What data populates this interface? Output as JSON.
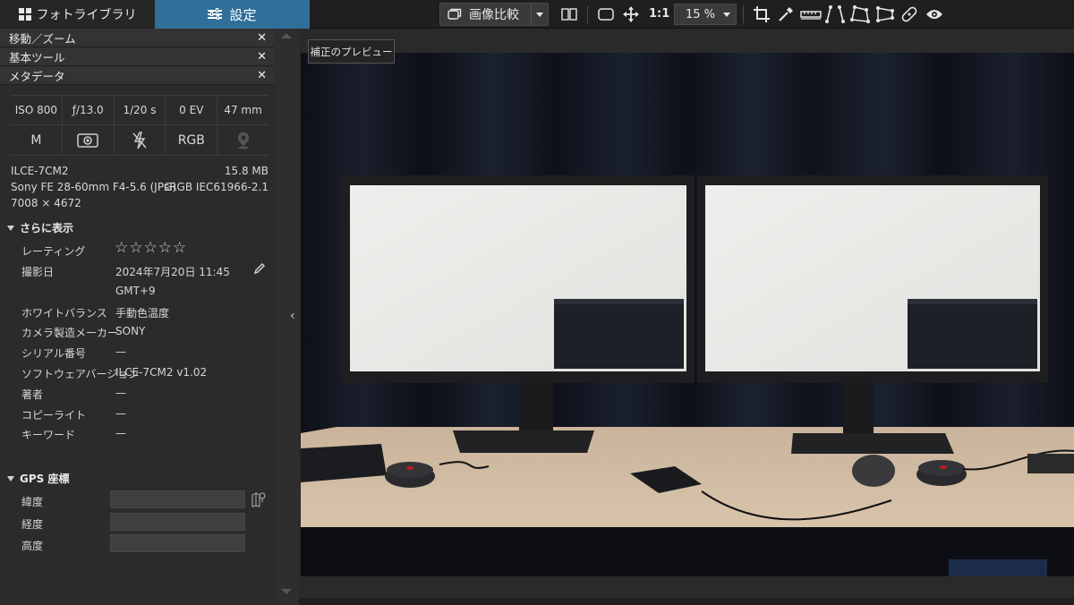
{
  "header": {
    "tab_library": "フォトライブラリ",
    "tab_settings": "設定",
    "compare_label": "画像比較",
    "zoom_ratio": "1:1",
    "zoom_value": "15 %"
  },
  "sections": {
    "move_zoom": "移動／ズーム",
    "basic_tools": "基本ツール",
    "metadata": "メタデータ"
  },
  "exif": {
    "iso": "ISO 800",
    "aperture": "ƒ/13.0",
    "shutter": "1/20 s",
    "ev": "0 EV",
    "focal": "47 mm",
    "mode": "M",
    "colorspace": "RGB"
  },
  "file": {
    "camera": "ILCE-7CM2",
    "size": "15.8 MB",
    "lens": "Sony FE 28-60mm F4-5.6 (JPG)",
    "profile": "sRGB IEC61966-2.1",
    "dimensions": "7008 × 4672"
  },
  "more": {
    "title": "さらに表示",
    "rating_label": "レーティング",
    "rating_stars": "☆☆☆☆☆",
    "date_label": "撮影日",
    "date_value": "2024年7月20日 11:45",
    "timezone": "GMT+9",
    "wb_label": "ホワイトバランス",
    "wb_value": "手動色温度",
    "maker_label": "カメラ製造メーカー",
    "maker_value": "SONY",
    "serial_label": "シリアル番号",
    "serial_value": "—",
    "software_label": "ソフトウェアバージョン",
    "software_value": "ILCE-7CM2 v1.02",
    "author_label": "著者",
    "author_value": "—",
    "copyright_label": "コピーライト",
    "copyright_value": "—",
    "keyword_label": "キーワード",
    "keyword_value": "—"
  },
  "gps": {
    "title": "GPS 座標",
    "lat_label": "緯度",
    "lon_label": "経度",
    "alt_label": "高度"
  },
  "preview": {
    "button_label": "補正のプレビュー"
  }
}
